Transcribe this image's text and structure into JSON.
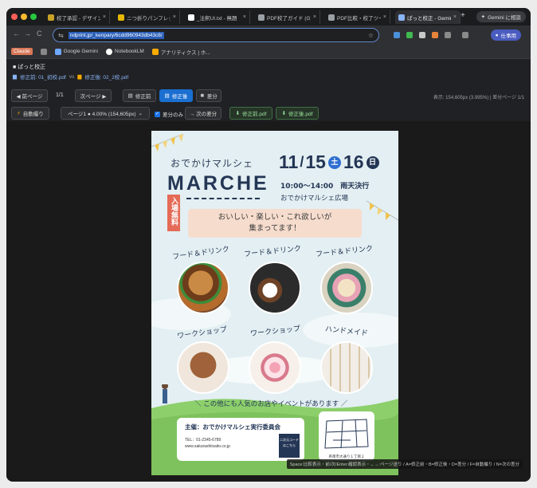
{
  "browser": {
    "tabs": [
      {
        "title": "校了承認 - デザイン",
        "favicon_color": "#c9a227",
        "active": false
      },
      {
        "title": "ニつ折りパンフレット",
        "favicon_color": "#e6b800",
        "active": false
      },
      {
        "title": "_注釈UI.txt - 無題",
        "favicon_color": "#ffffff",
        "active": false
      },
      {
        "title": "PDF校了ガイド (G)",
        "favicon_color": "#9aa0a6",
        "active": false
      },
      {
        "title": "PDF比較・校了ツール",
        "favicon_color": "#9aa0a6",
        "active": false
      },
      {
        "title": "ぱっと校正 - Gemini",
        "favicon_color": "#8ab4f8",
        "active": true
      }
    ],
    "new_tab": "+",
    "gemini_button": "Gemini に相談",
    "url": "ndprint.jp/_kenpary/6cdd960943db43c8/",
    "profile_button": "仕事用",
    "bookmarks": [
      {
        "label": "Claude",
        "icon": "claude-icon"
      },
      {
        "label": "",
        "icon": "apps-grid-icon"
      },
      {
        "label": "Google Gemini",
        "icon": "gemini-icon"
      },
      {
        "label": "NotebookLM",
        "icon": "notebooklm-icon"
      },
      {
        "label": "アナリティクス | ホ...",
        "icon": "analytics-icon"
      }
    ]
  },
  "app": {
    "title": "ぱっと校正",
    "before_file": "修正前: 01_初校.pdf",
    "vs": "vs",
    "after_file": "修正後: 02_2校.pdf",
    "toolbar1": {
      "prev_page": "◀ 前ページ",
      "page_counter": "1/1",
      "next_page": "次ページ ▶",
      "before_btn": "修正前",
      "after_btn": "修正後",
      "diff_btn": "差分",
      "status": "表示: 154,605px (3.995%) | 差分ページ 1/1"
    },
    "toolbar2": {
      "auto_btn": "自動撮り",
      "page_select": "ページ1 ● 4.00% (154,605px)",
      "diff_only": "差分のみ",
      "next_diff": "→ 次の差分",
      "download_before": "修正前.pdf",
      "download_after": "修正後.pdf"
    },
    "keyboard_hint": "Space:比較表示・前/次/Enter:確認表示・←→:ページ送り / A=修正前・B=修正後・D=差分 / F=自動撮り / N=次の差分"
  },
  "flyer": {
    "subtitle": "おでかけマルシェ",
    "title": "MARCHE",
    "vertical_label": "入場無料",
    "month": "11",
    "day1": "15",
    "dow1": "土",
    "day2": "16",
    "dow2": "日",
    "time": "10:00〜14:00　雨天決行",
    "place": "おでかけマルシェ広場",
    "banner_line1": "おいしい・楽しい・これ欲しいが",
    "banner_line2": "集まってます！",
    "categories": [
      "フード＆ドリンク",
      "フード＆ドリンク",
      "フード＆ドリンク",
      "ワークショップ",
      "ワークショップ",
      "ハンドメイド"
    ],
    "more_text": "＼ この他にも人気のお店やイベントがあります ／",
    "organizer": "主催：おでかけマルシェ実行委員会",
    "tel": "TEL：01-2345-6789",
    "web": "www.sakurashiisaito.co.jp",
    "qr_label": "二次元コードはこちら",
    "address": "県南市大通り１丁目２",
    "colors": {
      "navy": "#243655",
      "sat": "#2e6fd0",
      "sun": "#d64545",
      "accent": "#e56a57"
    }
  }
}
